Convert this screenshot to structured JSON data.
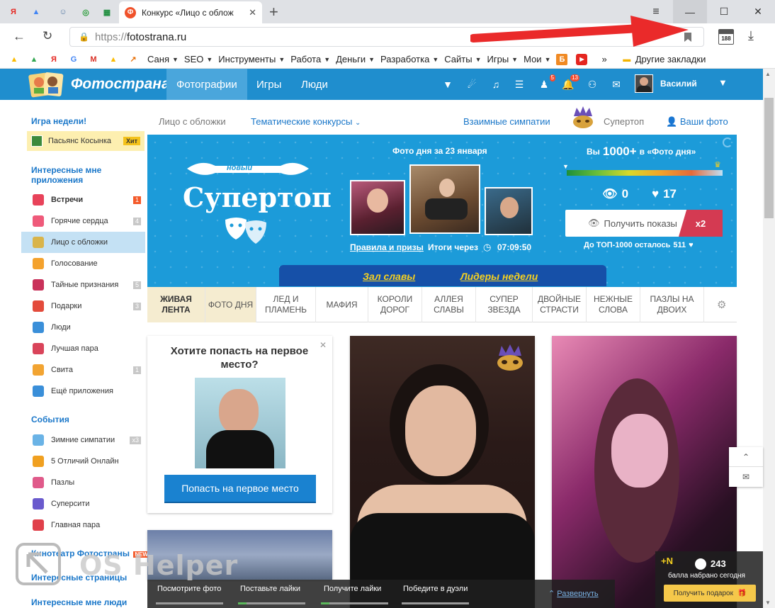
{
  "browser": {
    "pinned_tabs": [
      {
        "icon": "yandex-icon",
        "glyph": "Я",
        "color": "#e52620"
      },
      {
        "icon": "google-ads-icon",
        "glyph": "▲",
        "color": "#4285f4"
      },
      {
        "icon": "avatar-tab-icon",
        "glyph": "☺",
        "color": "#5a7ea6"
      },
      {
        "icon": "green-ring-icon",
        "glyph": "◎",
        "color": "#2e9e3e"
      },
      {
        "icon": "sheets-icon",
        "glyph": "▦",
        "color": "#1e8e3e"
      }
    ],
    "active_tab_title": "Конкурс «Лицо с облож",
    "active_tab_favicon": "Ф",
    "url_protocol": "https://",
    "url_host": "fotostrana.ru",
    "downloads_badge": "188",
    "bookmarks": [
      {
        "label": "",
        "icon": "drive-icon",
        "glyph": "▲",
        "color": "#fbbc04"
      },
      {
        "label": "",
        "icon": "drive2-icon",
        "glyph": "▲",
        "color": "#34a853"
      },
      {
        "label": "",
        "icon": "yandex-bm-icon",
        "glyph": "Я",
        "color": "#e52620"
      },
      {
        "label": "",
        "icon": "google-bm-icon",
        "glyph": "G",
        "color": "#4285f4"
      },
      {
        "label": "",
        "icon": "gmail-icon",
        "glyph": "M",
        "color": "#d93025"
      },
      {
        "label": "",
        "icon": "ads-bm-icon",
        "glyph": "▲",
        "color": "#fbbc04"
      },
      {
        "label": "",
        "icon": "analytics-icon",
        "glyph": "↗",
        "color": "#e8710a"
      },
      {
        "label": "Саня",
        "icon": "folder-icon",
        "caret": true
      },
      {
        "label": "SEO",
        "icon": "",
        "caret": true
      },
      {
        "label": "Инструменты",
        "icon": "",
        "caret": true
      },
      {
        "label": "Работа",
        "icon": "",
        "caret": true
      },
      {
        "label": "Деньги",
        "icon": "",
        "caret": true
      },
      {
        "label": "Разработка",
        "icon": "",
        "caret": true
      },
      {
        "label": "Сайты",
        "icon": "",
        "caret": true
      },
      {
        "label": "Игры",
        "icon": "",
        "caret": true
      },
      {
        "label": "Мои",
        "icon": "",
        "caret": true
      }
    ],
    "overflow": "»",
    "other_bookmarks": "Другие закладки"
  },
  "site": {
    "logo": "Фотострана",
    "nav": [
      "Фотографии",
      "Игры",
      "Люди"
    ],
    "user_name": "Василий",
    "badges": {
      "friends": "5",
      "notifications": "13"
    }
  },
  "sidebar": {
    "game_week_title": "Игра недели!",
    "game_week_item": "Пасьянс Косынка",
    "game_week_badge": "Хит",
    "apps_title": "Интересные мне приложения",
    "apps": [
      {
        "label": "Встречи",
        "count": "1",
        "bold": true,
        "color": "#e8435a"
      },
      {
        "label": "Горячие сердца",
        "count": "4",
        "color": "#ef5a7a"
      },
      {
        "label": "Лицо с обложки",
        "count": "",
        "active": true,
        "color": "#d9b44a"
      },
      {
        "label": "Голосование",
        "count": "",
        "color": "#f4a22d"
      },
      {
        "label": "Тайные признания",
        "count": "5",
        "color": "#c9325a"
      },
      {
        "label": "Подарки",
        "count": "3",
        "color": "#e34b3b"
      },
      {
        "label": "Люди",
        "count": "",
        "color": "#3a8fd9"
      },
      {
        "label": "Лучшая пара",
        "count": "",
        "color": "#d9445a"
      },
      {
        "label": "Свита",
        "count": "1",
        "color": "#f2a432"
      },
      {
        "label": "Ещё приложения",
        "count": "",
        "color": "#3a8fd9"
      }
    ],
    "events_title": "События",
    "events": [
      {
        "label": "Зимние симпатии",
        "count": "x3",
        "color": "#6ab3e6"
      },
      {
        "label": "5 Отличий Онлайн",
        "count": "",
        "color": "#f0a020"
      },
      {
        "label": "Пазлы",
        "count": "",
        "color": "#e05a8a"
      },
      {
        "label": "Суперсити",
        "count": "",
        "color": "#6a5acd"
      },
      {
        "label": "Главная пара",
        "count": "",
        "color": "#e0404a"
      }
    ],
    "cinema": "Кинотеатр Фотостраны",
    "cinema_badge": "NEW",
    "pages_title": "Интересные страницы",
    "people_title": "Интересные мне люди"
  },
  "subnav": {
    "cover": "Лицо с обложки",
    "themed": "Тематические конкурсы",
    "mutual": "Взаимные симпатии",
    "supertop": "Супертоп",
    "your_photos": "Ваши фото"
  },
  "banner": {
    "ribbon_small": "новый",
    "title": "Супертоп",
    "photo_day": "Фото дня за 23 января",
    "rules": "Правила и призы",
    "results": "Итоги через",
    "timer": "07:09:50",
    "rank_prefix": "Вы",
    "rank_value": "1000+",
    "rank_suffix": "в «Фото дня»",
    "views": "0",
    "likes": "17",
    "get_shows": "Получить показы",
    "multiplier": "x2",
    "left_to_top": "До ТОП-1000 осталось",
    "left_value": "511",
    "hall": "Зал славы",
    "leaders": "Лидеры недели"
  },
  "tabs": [
    {
      "label": "Живая лента",
      "active": true
    },
    {
      "label": "Фото дня",
      "active": false
    },
    {
      "label": "Лед и пламень"
    },
    {
      "label": "Мафия"
    },
    {
      "label": "Короли дорог"
    },
    {
      "label": "Аллея славы"
    },
    {
      "label": "Супер звезда"
    },
    {
      "label": "Двойные страсти"
    },
    {
      "label": "Нежные слова"
    },
    {
      "label": "Пазлы на двоих"
    }
  ],
  "promo": {
    "title": "Хотите попасть на первое место?",
    "button": "Попасть на первое место"
  },
  "bottom": {
    "steps": [
      "Посмотрите фото",
      "Поставьте лайки",
      "Получите лайки",
      "Победите в дуэли"
    ],
    "expand": "Развернуть",
    "points": "243",
    "points_prefix": "+N",
    "points_caption": "балла набрано сегодня",
    "gift_button": "Получить подарок"
  },
  "watermark": "OS Helper"
}
